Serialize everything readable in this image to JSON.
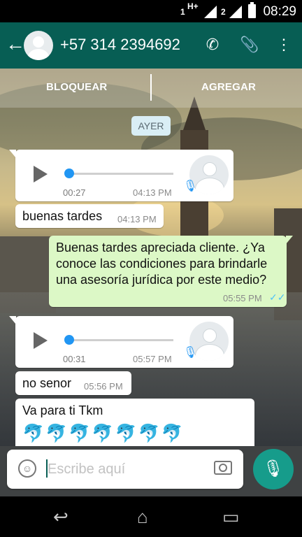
{
  "status_bar": {
    "network_label": "H+",
    "sim1": "1",
    "sim2": "2",
    "time": "08:29"
  },
  "header": {
    "contact": "+57 314 2394692"
  },
  "actions": {
    "block": "BLOQUEAR",
    "add": "AGREGAR"
  },
  "chat": {
    "day_label": "AYER",
    "messages": [
      {
        "type": "voice",
        "direction": "in",
        "duration": "00:27",
        "time": "04:13 PM"
      },
      {
        "type": "text",
        "direction": "in",
        "text": "buenas tardes",
        "time": "04:13 PM"
      },
      {
        "type": "text",
        "direction": "out",
        "text": "Buenas tardes apreciada cliente. ¿Ya conoce las condiciones para brindarle una asesoría jurídica por este medio?",
        "time": "05:55 PM"
      },
      {
        "type": "voice",
        "direction": "in",
        "duration": "00:31",
        "time": "05:57 PM"
      },
      {
        "type": "text",
        "direction": "in",
        "text": "no senor",
        "time": "05:56 PM"
      },
      {
        "type": "text",
        "direction": "in",
        "text": "Va para ti Tkm",
        "emoji": "🐬🐬🐬🐬🐬🐬🐬"
      }
    ]
  },
  "composer": {
    "placeholder": "Escribe aquí"
  },
  "colors": {
    "header": "#075e54",
    "outgoing": "#dcf8c6",
    "mic_button": "#169c8b",
    "accent": "#2196f3"
  },
  "icons": [
    "back-arrow-icon",
    "avatar-icon",
    "phone-icon",
    "paperclip-icon",
    "more-vert-icon",
    "play-icon",
    "mic-icon",
    "double-check-icon",
    "emoji-icon",
    "camera-icon",
    "nav-back-icon",
    "nav-home-icon",
    "nav-recents-icon"
  ]
}
